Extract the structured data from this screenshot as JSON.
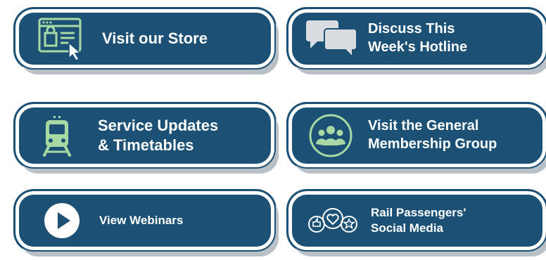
{
  "colors": {
    "button_fill": "#1c5175",
    "button_border": "#ffffff",
    "shadow": "#b9c0c6",
    "icon_green": "#a8d9a4"
  },
  "buttons": {
    "store": {
      "lines": [
        "Visit our Store"
      ],
      "icon": "store-icon"
    },
    "hotline": {
      "lines": [
        "Discuss This",
        "Week's Hotline"
      ],
      "icon": "chat-bubbles-icon"
    },
    "service": {
      "lines": [
        "Service Updates",
        "& Timetables"
      ],
      "icon": "train-icon"
    },
    "membership": {
      "lines": [
        "Visit the General",
        "Membership Group"
      ],
      "icon": "group-icon"
    },
    "webinars": {
      "lines": [
        "View Webinars"
      ],
      "icon": "play-icon"
    },
    "social": {
      "lines": [
        "Rail Passengers'",
        "Social Media"
      ],
      "icon": "social-media-icon"
    }
  }
}
